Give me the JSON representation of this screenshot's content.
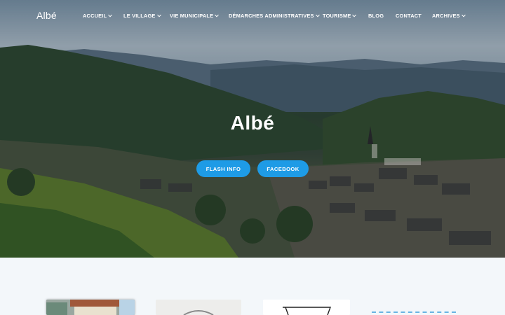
{
  "site": {
    "logo": "Albé"
  },
  "nav": {
    "items": [
      {
        "label": "ACCUEIL",
        "dropdown": true
      },
      {
        "label": "LE VILLAGE",
        "dropdown": true
      },
      {
        "label": "VIE MUNICIPALE",
        "dropdown": true
      },
      {
        "label": "DÉMARCHES ADMINISTRATIVES",
        "dropdown": true
      },
      {
        "label": "TOURISME",
        "dropdown": true
      },
      {
        "label": "BLOG",
        "dropdown": false
      },
      {
        "label": "CONTACT",
        "dropdown": false
      },
      {
        "label": "ARCHIVES",
        "dropdown": true
      }
    ]
  },
  "hero": {
    "title": "Albé",
    "buttons": [
      {
        "label": "FLASH INFO"
      },
      {
        "label": "FACEBOOK"
      }
    ]
  },
  "colors": {
    "accent": "#1e9be6",
    "content_bg": "#f3f7fa",
    "nav_text": "#ffffff"
  }
}
